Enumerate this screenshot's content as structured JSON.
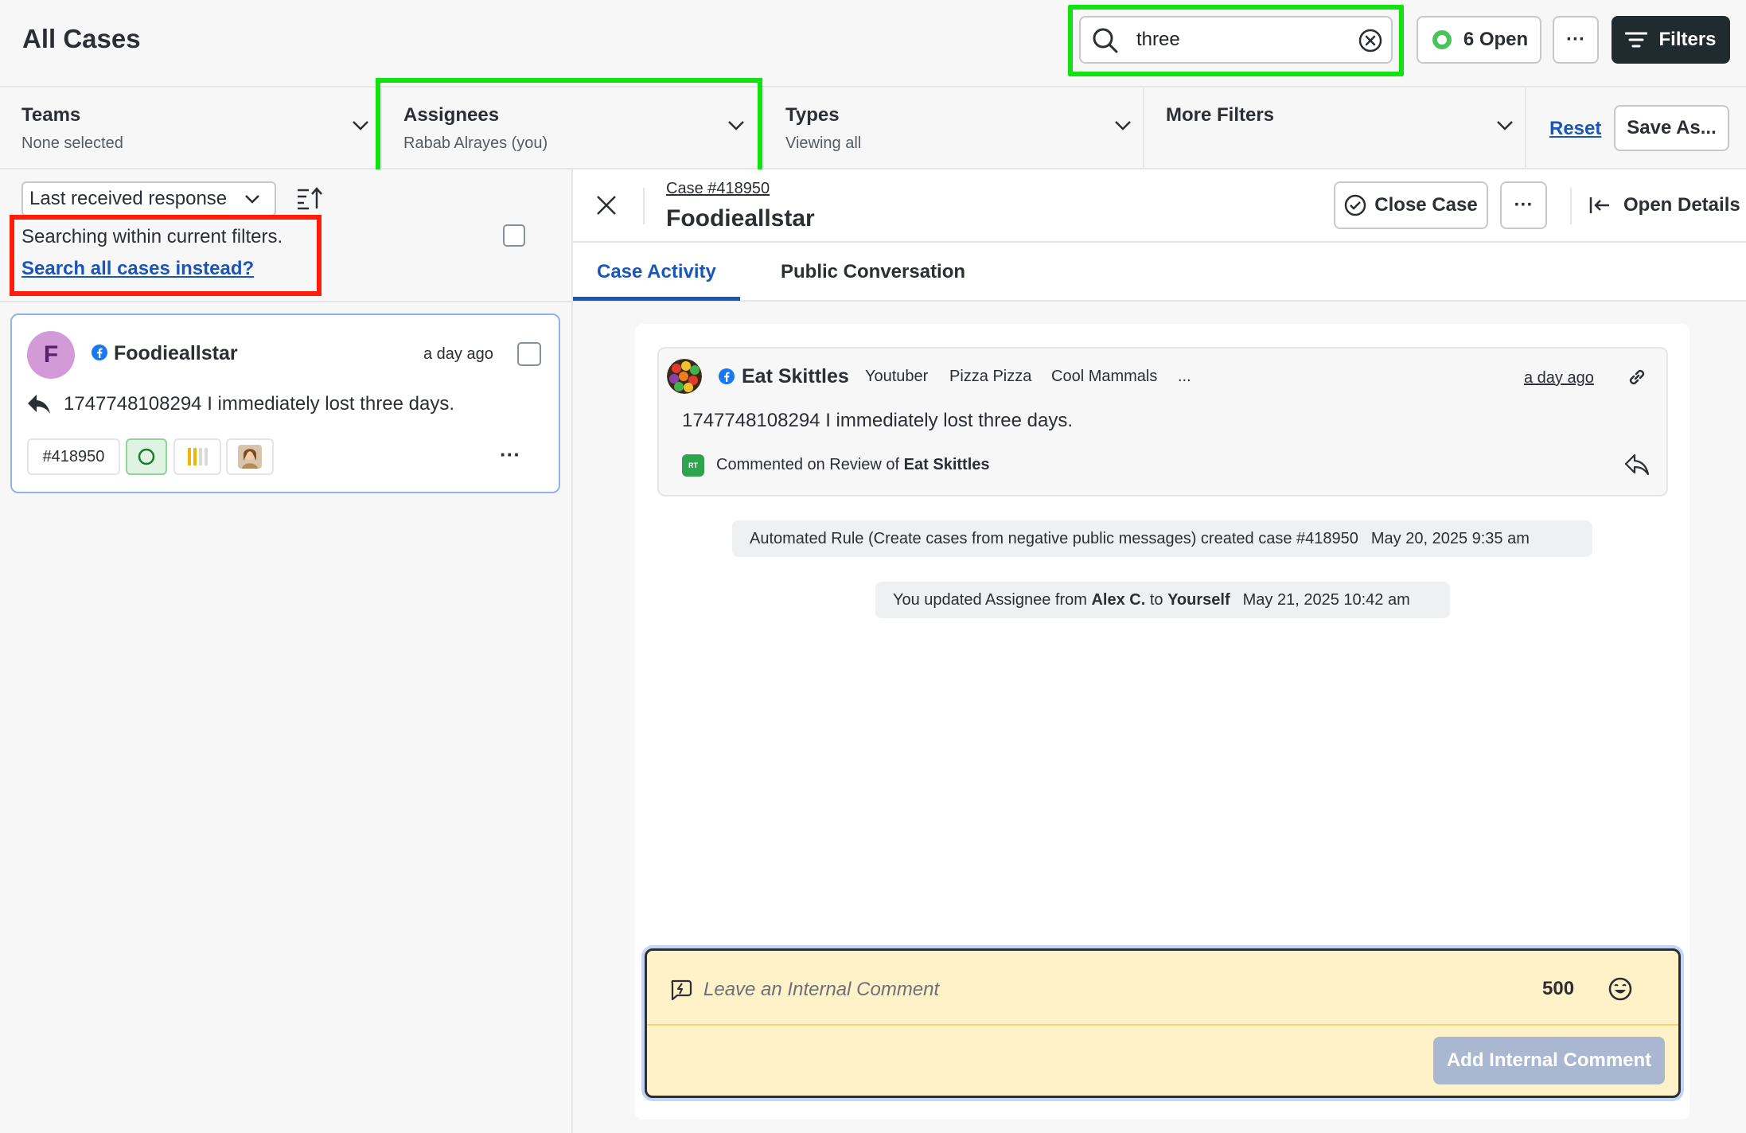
{
  "header": {
    "title": "All Cases",
    "search": {
      "value": "three",
      "placeholder": "Search"
    },
    "open_count_label": "6 Open",
    "more_label": "···",
    "filters_label": "Filters"
  },
  "filters": {
    "teams": {
      "title": "Teams",
      "value": "None selected"
    },
    "assignees": {
      "title": "Assignees",
      "value": "Rabab Alrayes (you)"
    },
    "types": {
      "title": "Types",
      "value": "Viewing all"
    },
    "more": {
      "title": "More Filters",
      "value": ""
    },
    "reset_label": "Reset",
    "save_as_label": "Save As..."
  },
  "list": {
    "sort_label": "Last received response",
    "notice": "Searching within current filters.",
    "search_all_label": "Search all cases instead?",
    "cases": [
      {
        "avatar_letter": "F",
        "author": "Foodieallstar",
        "time": "a day ago",
        "message": "1747748108294 I immediately lost three days.",
        "case_number": "#418950",
        "more_label": "···"
      }
    ]
  },
  "detail": {
    "case_number": "Case #418950",
    "title": "Foodieallstar",
    "close_case_label": "Close Case",
    "more_label": "···",
    "open_details_label": "Open Details",
    "tabs": [
      {
        "label": "Case Activity",
        "active": true
      },
      {
        "label": "Public Conversation",
        "active": false
      }
    ],
    "message": {
      "author": "Eat Skittles",
      "tags": [
        "Youtuber",
        "Pizza Pizza",
        "Cool Mammals",
        "..."
      ],
      "time": "a day ago",
      "text": "1747748108294 I immediately lost three days.",
      "source_prefix": "Commented on Review of",
      "source_name": "Eat Skittles",
      "source_icon_label": "RT"
    },
    "events": [
      {
        "text": "Automated Rule (Create cases from negative public messages) created case #418950",
        "date": "May 20, 2025 9:35 am"
      },
      {
        "text_prefix": "You updated Assignee from",
        "from": "Alex C.",
        "text_mid": "to",
        "to": "Yourself",
        "date": "May 21, 2025 10:42 am"
      }
    ],
    "comment": {
      "placeholder": "Leave an Internal Comment",
      "char_count": "500",
      "submit_label": "Add Internal Comment"
    }
  },
  "colors": {
    "accent": "#1a56b8",
    "highlight_green": "#12e212",
    "highlight_red": "#ff1d0a",
    "status_open": "#4cc35a",
    "comment_bg": "#fff1c8"
  }
}
